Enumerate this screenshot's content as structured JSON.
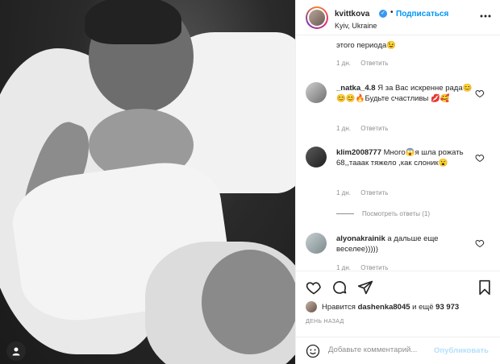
{
  "header": {
    "username": "kvittkova",
    "verified_mark": "✓",
    "separator": "•",
    "follow_label": "Подписаться",
    "location": "Kyiv, Ukraine",
    "more_icon": "more-dots-icon"
  },
  "comments": [
    {
      "username": "",
      "text": "этого периода😉",
      "time": "1 дн.",
      "reply": "Ответить"
    },
    {
      "username": "_natka_4.8",
      "text": " Я за Вас искренне рада😊😊😊🔥Будьте счастливы 💋🥰",
      "time": "1 дн.",
      "reply": "Ответить",
      "avatar_color": "#8f8f8f"
    },
    {
      "username": "klim2008777",
      "text": " Много😱я шла рожать 68,,тааак тяжело ,как слоник😮",
      "time": "1 дн.",
      "reply": "Ответить",
      "avatar_color": "#3a3a3a",
      "view_replies": "Посмотреть ответы (1)"
    },
    {
      "username": "alyonakrainik",
      "text": " а дальше еще веселее)))))",
      "time": "1 дн.",
      "reply": "Ответить",
      "avatar_color": "#9aa6a8"
    }
  ],
  "likes": {
    "prefix": "Нравится",
    "user": "dashenka8045",
    "middle": "и ещё",
    "count": "93 973"
  },
  "timestamp": "ДЕНЬ НАЗАД",
  "add_comment": {
    "placeholder": "Добавьте комментарий...",
    "post_label": "Опубликовать"
  },
  "colors": {
    "accent": "#0095f6",
    "post_disabled": "#b2dffc",
    "muted": "#8e8e8e"
  }
}
